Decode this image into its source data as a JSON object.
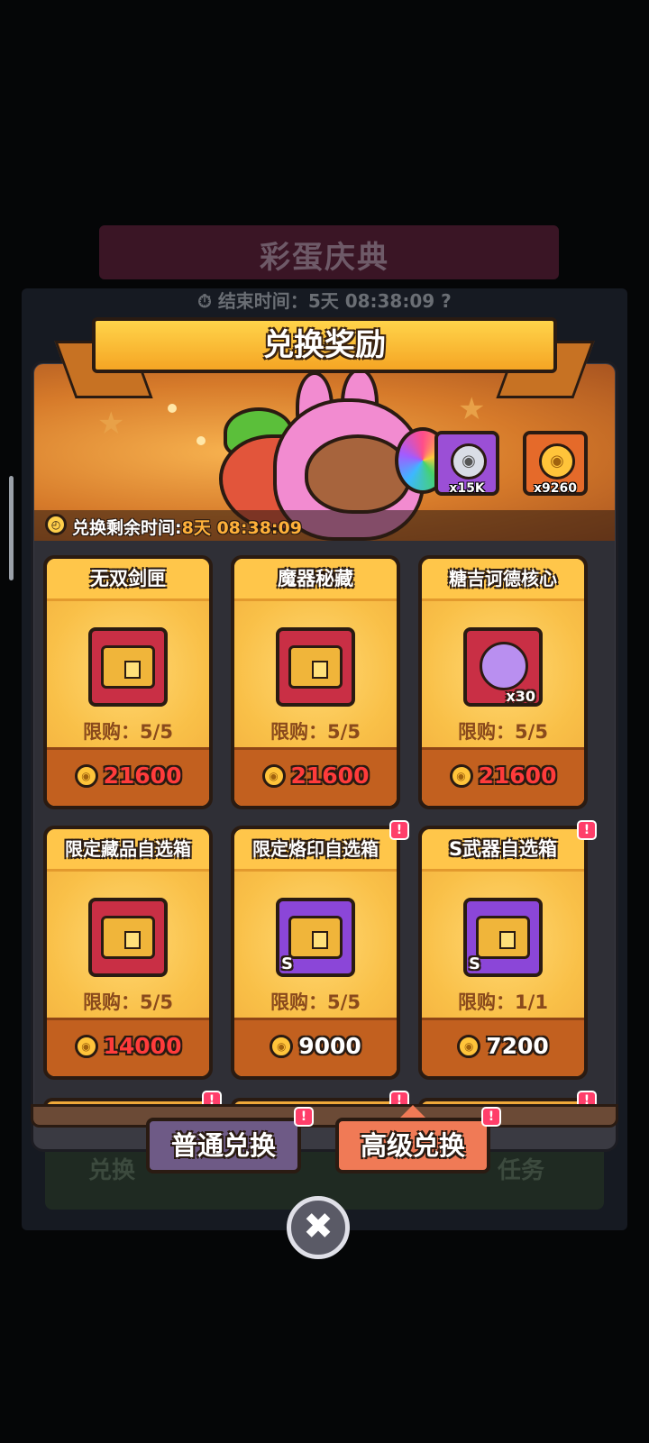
{
  "background": {
    "event_title": "彩蛋庆典",
    "timer_label": "结束时间：",
    "timer_value": "5天 08:38:09",
    "ghost_tabs": [
      "兑换",
      "任务"
    ]
  },
  "header": {
    "title": "兑换奖励"
  },
  "banner": {
    "currencies": [
      {
        "icon": "silver-bunny-coin-icon",
        "count": "x15K"
      },
      {
        "icon": "gold-bunny-coin-icon",
        "count": "x9260"
      }
    ],
    "remaining_label": "兑换剩余时间:",
    "remaining_value": "8天 08:38:09"
  },
  "items": [
    {
      "title": "无双剑匣",
      "limit": "限购：5/5",
      "price": "21600",
      "price_color": "#ff3b3b",
      "box": "red",
      "icon": "weapon-chest-icon",
      "alert": false
    },
    {
      "title": "魔器秘藏",
      "limit": "限购：5/5",
      "price": "21600",
      "price_color": "#ff3b3b",
      "box": "red",
      "icon": "artifact-chest-icon",
      "alert": false
    },
    {
      "title": "糖吉诃德核心",
      "limit": "限购：5/5",
      "price": "21600",
      "price_color": "#ff3b3b",
      "box": "red",
      "icon": "core-medal-icon",
      "qty": "x30",
      "alert": false
    },
    {
      "title": "限定藏品自选箱",
      "limit": "限购：5/5",
      "price": "14000",
      "price_color": "#ff3b3b",
      "box": "red",
      "icon": "collectible-chest-icon",
      "alert": false
    },
    {
      "title": "限定烙印自选箱",
      "limit": "限购：5/5",
      "price": "9000",
      "price_color": "#ffffff",
      "box": "purple",
      "icon": "brand-chest-icon",
      "tag": "S",
      "alert": true
    },
    {
      "title": "S武器自选箱",
      "limit": "限购：1/1",
      "price": "7200",
      "price_color": "#ffffff",
      "box": "purple",
      "icon": "weapon-select-chest-icon",
      "tag": "S",
      "alert": true
    }
  ],
  "tabs": {
    "normal": "普通兑换",
    "advanced": "高级兑换",
    "active": "advanced"
  },
  "close_label": "✖"
}
